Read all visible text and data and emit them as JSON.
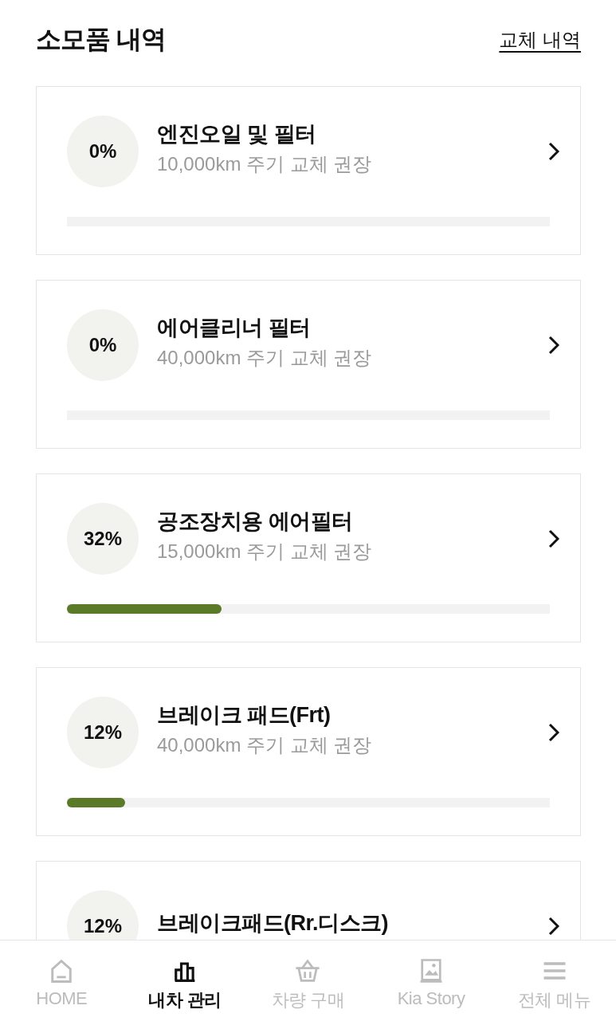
{
  "header": {
    "title": "소모품 내역",
    "link": "교체 내역"
  },
  "items": [
    {
      "percent": "0%",
      "name": "엔진오일 및 필터",
      "interval": "10,000km 주기 교체 권장"
    },
    {
      "percent": "0%",
      "name": "에어클리너 필터",
      "interval": "40,000km 주기 교체 권장"
    },
    {
      "percent": "32%",
      "name": "공조장치용 에어필터",
      "interval": "15,000km 주기 교체 권장",
      "level": 0.32
    },
    {
      "percent": "12%",
      "name": "브레이크 패드(Frt)",
      "interval": "40,000km 주기 교체 권장",
      "level": 0.12
    },
    {
      "percent": "12%",
      "name": "브레이크패드(Rr.디스크)"
    }
  ],
  "nav": [
    {
      "kind": "home",
      "label": "HOME",
      "selected": false
    },
    {
      "kind": "chart",
      "label": "내차 관리",
      "selected": true
    },
    {
      "kind": "basket",
      "label": "차량 구매",
      "selected": false
    },
    {
      "kind": "picture",
      "label": "Kia Story",
      "selected": false
    },
    {
      "kind": "menu",
      "label": "전체 메뉴",
      "selected": false
    }
  ]
}
